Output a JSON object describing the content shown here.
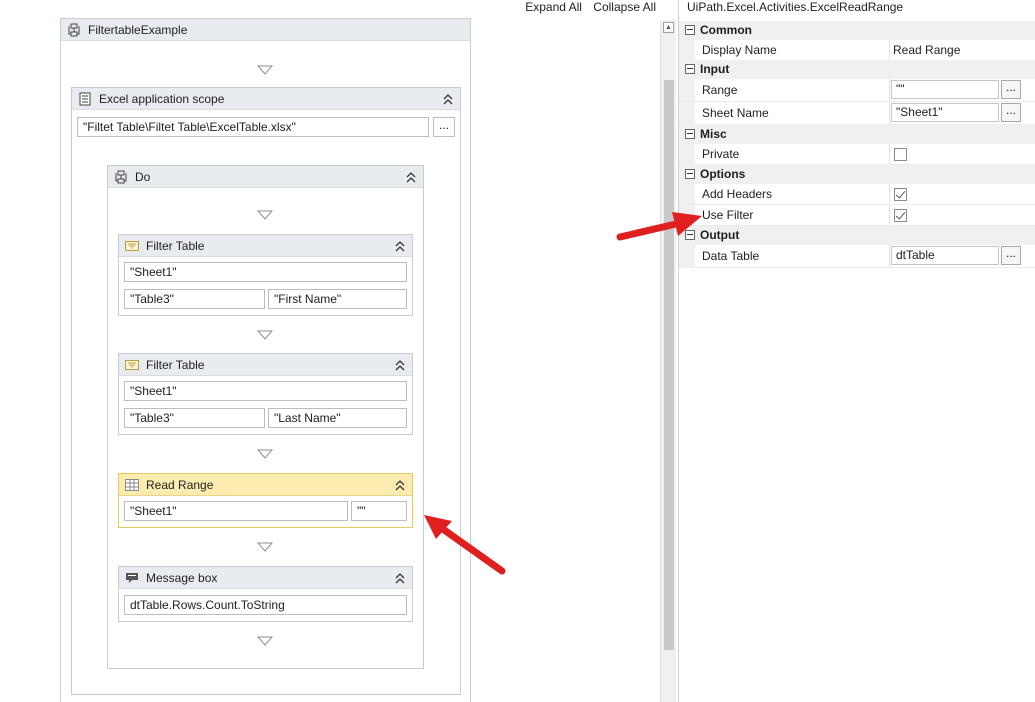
{
  "toolbar": {
    "expand_all": "Expand All",
    "collapse_all": "Collapse All"
  },
  "workflow": {
    "root_title": "FiltertableExample",
    "scope": {
      "title": "Excel application scope",
      "path": "\"Filtet Table\\Filtet Table\\ExcelTable.xlsx\"",
      "browse": "..."
    },
    "do_title": "Do",
    "activities": [
      {
        "title": "Filter Table",
        "sheet": "\"Sheet1\"",
        "table": "\"Table3\"",
        "column": "\"First Name\""
      },
      {
        "title": "Filter Table",
        "sheet": "\"Sheet1\"",
        "table": "\"Table3\"",
        "column": "\"Last Name\""
      }
    ],
    "read_range": {
      "title": "Read Range",
      "sheet": "\"Sheet1\"",
      "range": "\"\"",
      "selected": true,
      "accent": "#fcecb0"
    },
    "message_box": {
      "title": "Message box",
      "text": "dtTable.Rows.Count.ToString"
    }
  },
  "properties": {
    "title": "UiPath.Excel.Activities.ExcelReadRange",
    "categories": [
      {
        "name": "Common",
        "rows": [
          {
            "name": "Display Name",
            "value": "Read Range"
          }
        ]
      },
      {
        "name": "Input",
        "rows": [
          {
            "name": "Range",
            "value": "\"\""
          },
          {
            "name": "Sheet Name",
            "value": "\"Sheet1\""
          }
        ]
      },
      {
        "name": "Misc",
        "rows": [
          {
            "name": "Private",
            "checked": false
          }
        ]
      },
      {
        "name": "Options",
        "rows": [
          {
            "name": "Add Headers",
            "checked": true
          },
          {
            "name": "Use Filter",
            "checked": true
          }
        ]
      },
      {
        "name": "Output",
        "rows": [
          {
            "name": "Data Table",
            "value": "dtTable"
          }
        ]
      }
    ],
    "button_label": "..."
  },
  "colors": {
    "header_bg": "#e8ecf0",
    "selected_header": "#fcecb0",
    "annotation_arrow": "#e02020"
  }
}
